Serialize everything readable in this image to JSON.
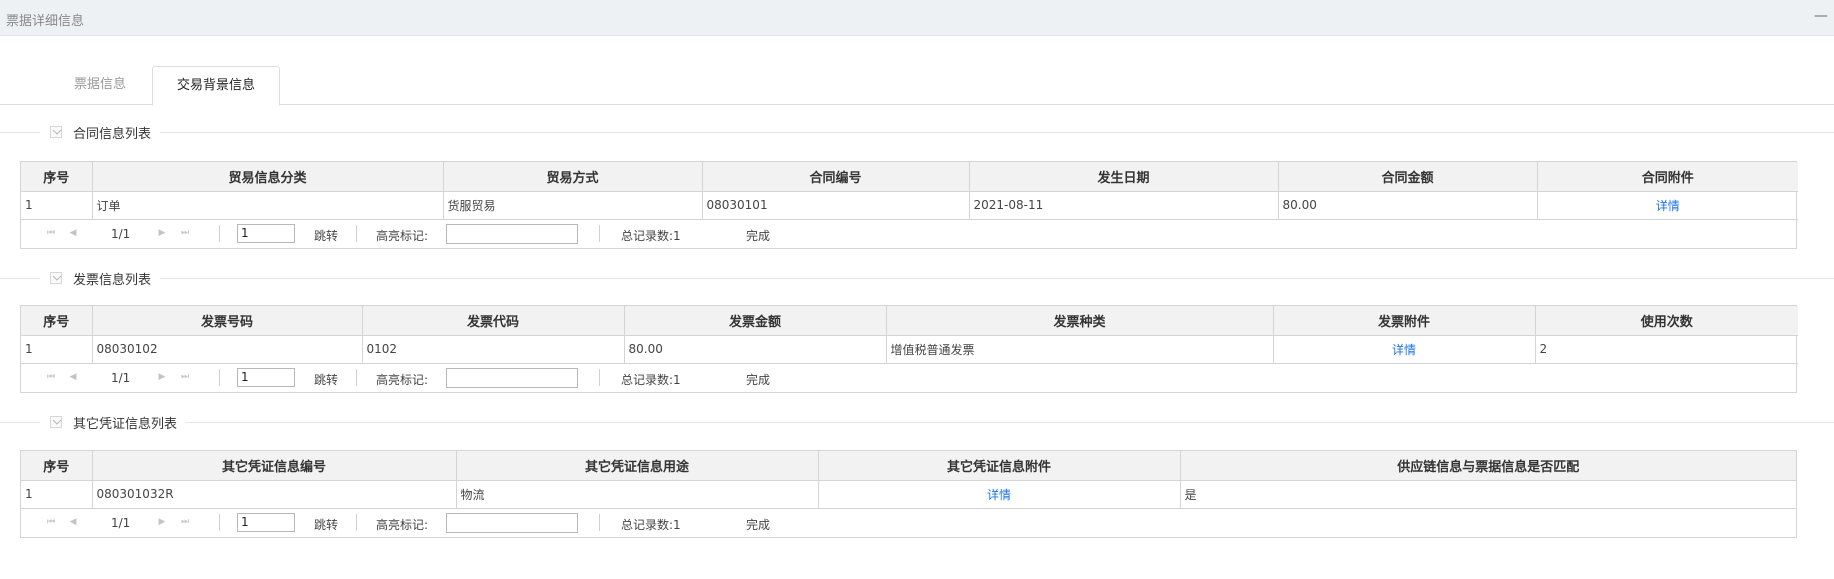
{
  "header": {
    "title": "票据详细信息",
    "minimize": "—"
  },
  "tabs": [
    {
      "label": "票据信息",
      "active": false
    },
    {
      "label": "交易背景信息",
      "active": true
    }
  ],
  "pager_labels": {
    "jump": "跳转",
    "highlight": "高亮标记:",
    "done": "完成"
  },
  "contract": {
    "title": "合同信息列表",
    "columns": [
      "序号",
      "贸易信息分类",
      "贸易方式",
      "合同编号",
      "发生日期",
      "合同金额",
      "合同附件"
    ],
    "rows": [
      [
        "1",
        "订单",
        "货服贸易",
        "08030101",
        "2021-08-11",
        "80.00",
        "详情"
      ]
    ],
    "pager": {
      "page_info": "1/1",
      "page_input": "1",
      "total": "总记录数:1"
    }
  },
  "invoice": {
    "title": "发票信息列表",
    "columns": [
      "序号",
      "发票号码",
      "发票代码",
      "发票金额",
      "发票种类",
      "发票附件",
      "使用次数"
    ],
    "rows": [
      [
        "1",
        "08030102",
        "0102",
        "80.00",
        "增值税普通发票",
        "详情",
        "2"
      ]
    ],
    "pager": {
      "page_info": "1/1",
      "page_input": "1",
      "total": "总记录数:1"
    }
  },
  "other": {
    "title": "其它凭证信息列表",
    "columns": [
      "序号",
      "其它凭证信息编号",
      "其它凭证信息用途",
      "其它凭证信息附件",
      "供应链信息与票据信息是否匹配"
    ],
    "rows": [
      [
        "1",
        "080301032R",
        "物流",
        "详情",
        "是"
      ]
    ],
    "pager": {
      "page_info": "1/1",
      "page_input": "1",
      "total": "总记录数:1"
    }
  },
  "colors": {
    "link": "#1a73e8",
    "header_bg": "#f2f2f2",
    "border": "#d4d4d4",
    "topbar_bg": "#eef1f4"
  }
}
